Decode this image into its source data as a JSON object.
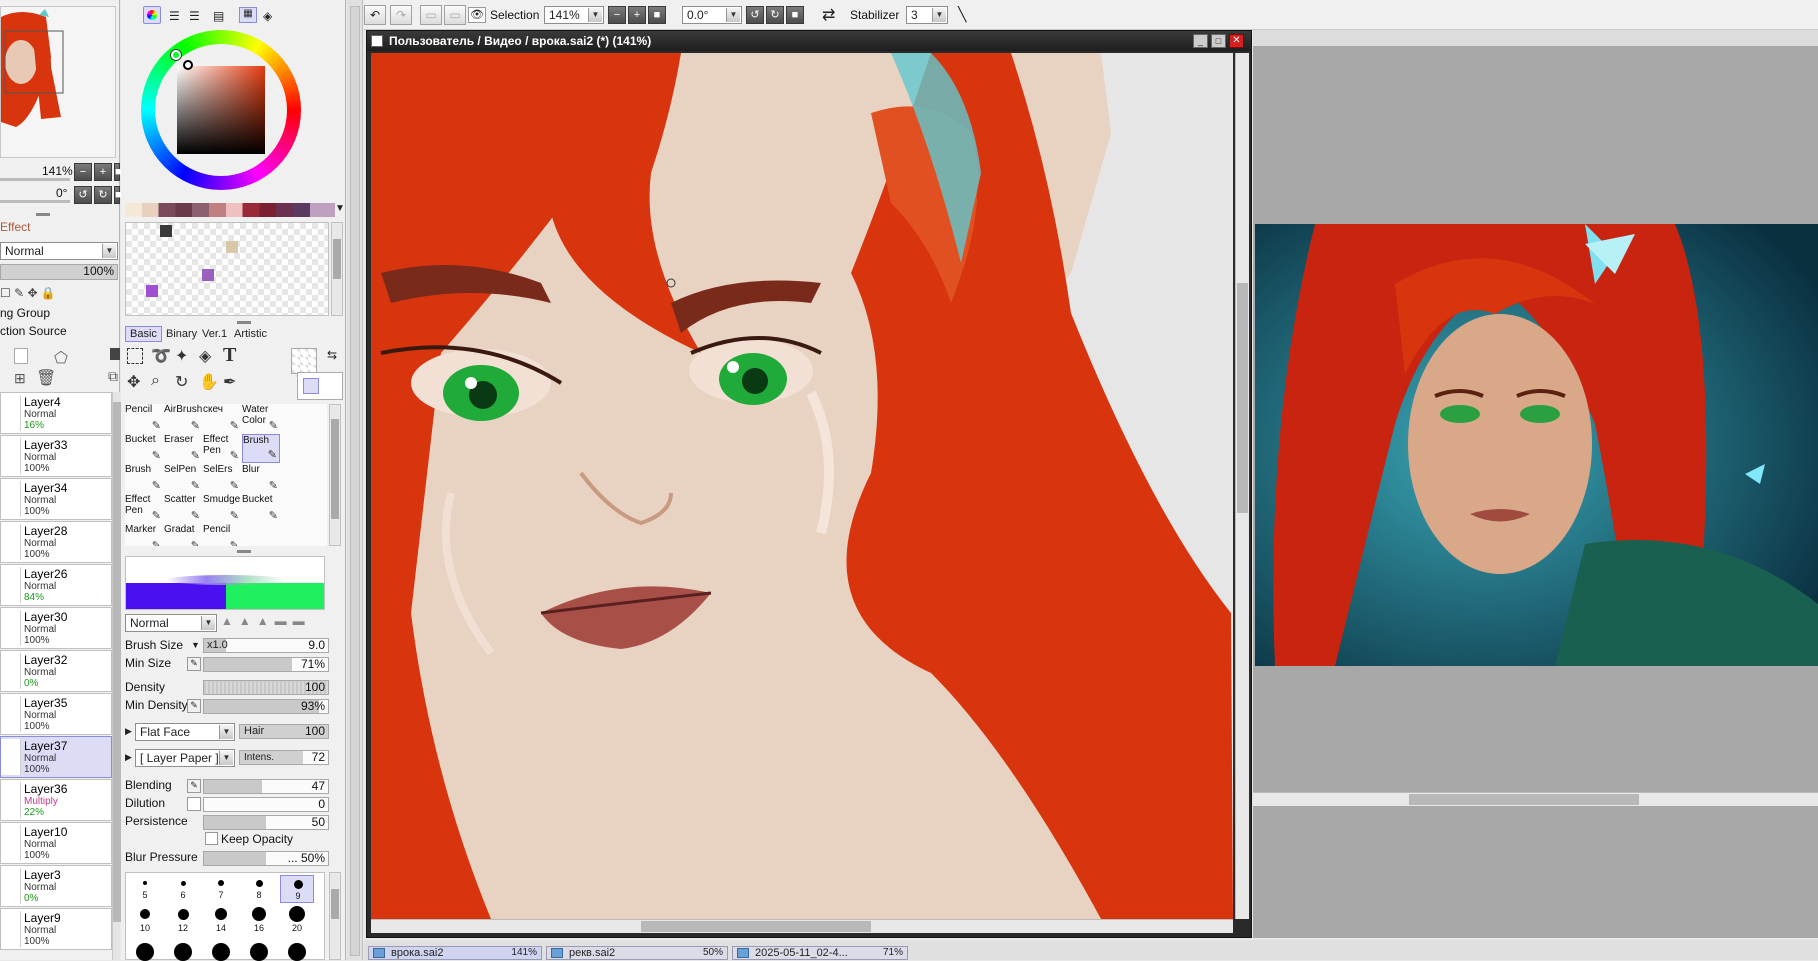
{
  "navigator": {
    "zoom": "141%",
    "angle": "0°"
  },
  "layer_panel": {
    "effect_label": "Effect",
    "blend_mode": "Normal",
    "opacity": "100%",
    "group_label": "ng Group",
    "source_label": "ction Source",
    "layers": [
      {
        "name": "Layer4",
        "mode": "Normal",
        "opacity": "16%",
        "green": true
      },
      {
        "name": "Layer33",
        "mode": "Normal",
        "opacity": "100%"
      },
      {
        "name": "Layer34",
        "mode": "Normal",
        "opacity": "100%"
      },
      {
        "name": "Layer28",
        "mode": "Normal",
        "opacity": "100%"
      },
      {
        "name": "Layer26",
        "mode": "Normal",
        "opacity": "84%",
        "green": true
      },
      {
        "name": "Layer30",
        "mode": "Normal",
        "opacity": "100%"
      },
      {
        "name": "Layer32",
        "mode": "Normal",
        "opacity": "0%",
        "green": true
      },
      {
        "name": "Layer35",
        "mode": "Normal",
        "opacity": "100%"
      },
      {
        "name": "Layer37",
        "mode": "Normal",
        "opacity": "100%",
        "selected": true
      },
      {
        "name": "Layer36",
        "mode": "Multiply",
        "opacity": "22%",
        "green": true
      },
      {
        "name": "Layer10",
        "mode": "Normal",
        "opacity": "100%"
      },
      {
        "name": "Layer3",
        "mode": "Normal",
        "opacity": "0%",
        "green": true
      },
      {
        "name": "Layer9",
        "mode": "Normal",
        "opacity": "100%"
      }
    ]
  },
  "tool_panel": {
    "tabs": [
      "Basic",
      "Binary",
      "Ver.1",
      "Artistic"
    ],
    "tools": [
      {
        "label": "Pencil"
      },
      {
        "label": "AirBrush"
      },
      {
        "label": "скеч"
      },
      {
        "label": "Water Color"
      },
      {
        "label": "Bucket"
      },
      {
        "label": "Eraser"
      },
      {
        "label": "Effect Pen"
      },
      {
        "label": "Brush",
        "selected": true
      },
      {
        "label": "Brush"
      },
      {
        "label": "SelPen"
      },
      {
        "label": "SelErs"
      },
      {
        "label": "Blur"
      },
      {
        "label": "Effect Pen"
      },
      {
        "label": "Scatter"
      },
      {
        "label": "Smudge"
      },
      {
        "label": "Bucket"
      },
      {
        "label": "Marker"
      },
      {
        "label": "Gradat"
      },
      {
        "label": "Pencil"
      }
    ],
    "blend_mode": "Normal",
    "brush_size_mult": "x1.0",
    "brush_size": "9.0",
    "min_size": "71%",
    "density": "100",
    "min_density": "93%",
    "shape": "Flat Face",
    "shape_sub": "Hair",
    "shape_value": "100",
    "texture": "[ Layer Paper ]",
    "texture_sub": "Intens.",
    "texture_value": "72",
    "blending": "47",
    "dilution": "0",
    "persistence": "50",
    "keep_opacity": "Keep Opacity",
    "blur_pressure": "... 50%",
    "labels": {
      "brush_size": "Brush Size",
      "min_size": "Min Size",
      "density": "Density",
      "min_density": "Min Density",
      "blending": "Blending",
      "dilution": "Dilution",
      "persistence": "Persistence",
      "blur_pressure": "Blur Pressure"
    },
    "presets_row1": [
      "5",
      "6",
      "7",
      "8",
      "9"
    ],
    "presets_row2": [
      "10",
      "12",
      "14",
      "16",
      "20"
    ]
  },
  "toolbar": {
    "selection_label": "Selection",
    "zoom": "141%",
    "angle": "0.0°",
    "stabilizer_label": "Stabilizer",
    "stabilizer_value": "3"
  },
  "canvas_window": {
    "title": "Пользователь / Видео / врока.sai2 (*) (141%)"
  },
  "doc_tabs": [
    {
      "name": "врока.sai2",
      "zoom": "141%"
    },
    {
      "name": "рекв.sai2",
      "zoom": "50%"
    },
    {
      "name": "2025-05-11_02-4...",
      "zoom": "71%"
    }
  ],
  "colors": {
    "accent": "#8a8ae0",
    "hair": "#d8350e",
    "skin": "#e8d0bf"
  }
}
